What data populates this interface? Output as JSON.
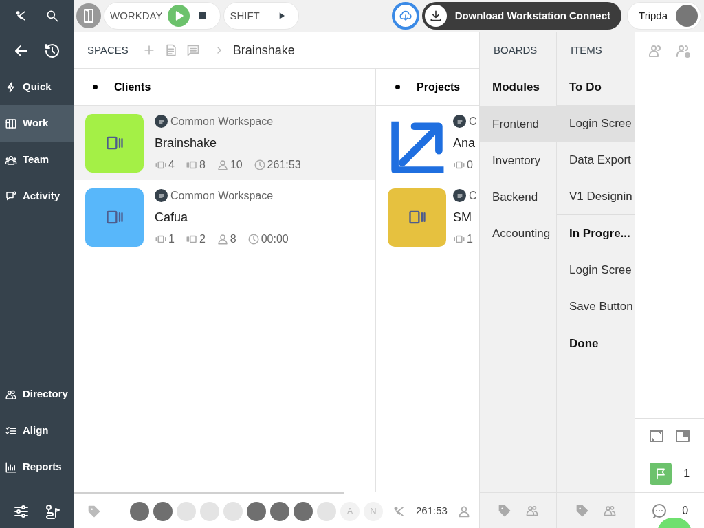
{
  "sidebar": {
    "nav": [
      {
        "label": "Quick",
        "selected": false
      },
      {
        "label": "Work",
        "selected": true
      },
      {
        "label": "Team",
        "selected": false
      },
      {
        "label": "Activity",
        "selected": false
      }
    ],
    "lower_nav": [
      {
        "label": "Directory",
        "selected": false
      },
      {
        "label": "Align",
        "selected": false
      },
      {
        "label": "Reports",
        "selected": false
      }
    ]
  },
  "topbar": {
    "workday": {
      "label": "WORKDAY",
      "running": true
    },
    "shift": {
      "label": "SHIFT"
    },
    "download": {
      "label": "Download Workstation Connect"
    },
    "user": {
      "name": "Tripda"
    }
  },
  "breadcrumb": {
    "root": "SPACES",
    "current": "Brainshake"
  },
  "columns": [
    {
      "title": "Clients",
      "cards": [
        {
          "kind": "tile",
          "color": "#a4f046",
          "workspace": "Common Workspace",
          "title": "Brainshake",
          "selected": true,
          "stats": [
            "4",
            "8",
            "10",
            "261:53"
          ]
        },
        {
          "kind": "tile",
          "color": "#58b7fa",
          "workspace": "Common Workspace",
          "title": "Cafua",
          "selected": false,
          "stats": [
            "1",
            "2",
            "8",
            "00:00"
          ]
        }
      ]
    },
    {
      "title": "Projects",
      "cards": [
        {
          "kind": "chart",
          "workspace": "C",
          "title": "Ana",
          "selected": false,
          "stats": [
            "0"
          ]
        },
        {
          "kind": "tile",
          "color": "#e6c13f",
          "workspace": "C",
          "title": "SM",
          "selected": false,
          "stats": [
            "1"
          ]
        }
      ]
    }
  ],
  "boards": {
    "header": "BOARDS",
    "group": "Modules",
    "items": [
      {
        "label": "Frontend",
        "selected": true
      },
      {
        "label": "Inventory",
        "selected": false
      },
      {
        "label": "Backend",
        "selected": false
      },
      {
        "label": "Accounting",
        "selected": false
      }
    ]
  },
  "items": {
    "header": "ITEMS",
    "groups": [
      {
        "title": "To Do",
        "items": [
          {
            "label": "Login Scree",
            "selected": true
          },
          {
            "label": "Data Export",
            "selected": false
          },
          {
            "label": "V1 Designin",
            "selected": false
          }
        ]
      },
      {
        "title": "In Progre...",
        "items": [
          {
            "label": "Login Scree",
            "selected": false
          },
          {
            "label": "Save Button",
            "selected": false
          }
        ]
      },
      {
        "title": "Done"
      }
    ]
  },
  "bottom_bar": {
    "avatars": [
      {
        "kind": "photo",
        "faded": false
      },
      {
        "kind": "photo",
        "faded": false
      },
      {
        "kind": "photo",
        "faded": true
      },
      {
        "kind": "photo",
        "faded": true
      },
      {
        "kind": "photo",
        "faded": true
      },
      {
        "kind": "photo",
        "faded": false
      },
      {
        "kind": "photo",
        "faded": false
      },
      {
        "kind": "photo",
        "faded": false
      },
      {
        "kind": "photo",
        "faded": true
      },
      {
        "kind": "letter",
        "letter": "A",
        "faded": true
      },
      {
        "kind": "letter",
        "letter": "N",
        "faded": true
      }
    ],
    "time": "261:53"
  },
  "right_rail": {
    "flag_count": "1",
    "comment_count": "0"
  }
}
